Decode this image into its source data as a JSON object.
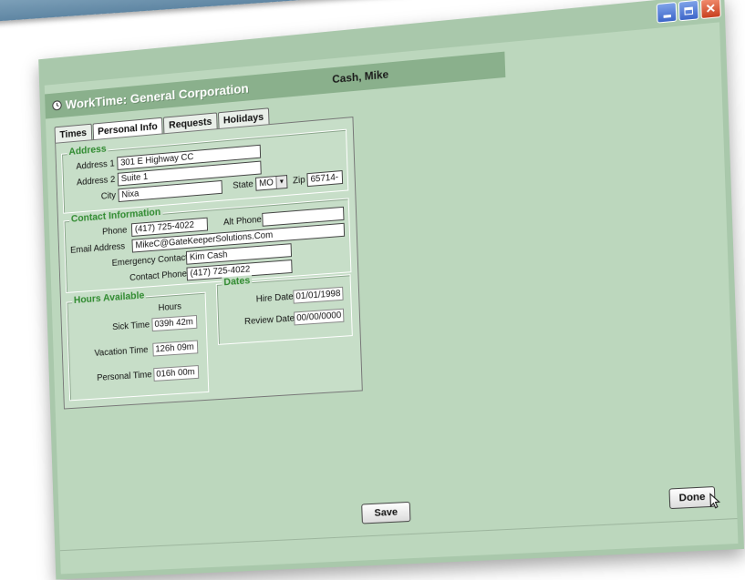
{
  "window": {
    "app_title": "WorkTime: General Corporation",
    "user_name": "Cash, Mike"
  },
  "tabs": [
    {
      "label": "Times"
    },
    {
      "label": "Personal Info"
    },
    {
      "label": "Requests"
    },
    {
      "label": "Holidays"
    }
  ],
  "address": {
    "group_label": "Address",
    "address1_label": "Address 1",
    "address1_value": "301 E Highway CC",
    "address2_label": "Address 2",
    "address2_value": "Suite 1",
    "city_label": "City",
    "city_value": "Nixa",
    "state_label": "State",
    "state_value": "MO",
    "zip_label": "Zip",
    "zip_value": "65714-"
  },
  "contact": {
    "group_label": "Contact Information",
    "phone_label": "Phone",
    "phone_value": "(417) 725-4022",
    "alt_phone_label": "Alt Phone",
    "alt_phone_value": "",
    "email_label": "Email Address",
    "email_value": "MikeC@GateKeeperSolutions.Com",
    "emergency_label": "Emergency Contact",
    "emergency_value": "Kim Cash",
    "contact_phone_label": "Contact Phone",
    "contact_phone_value": "(417) 725-4022"
  },
  "hours": {
    "group_label": "Hours Available",
    "column_header": "Hours",
    "rows": [
      {
        "label": "Sick Time",
        "value": "039h 42m"
      },
      {
        "label": "Vacation Time",
        "value": "126h 09m"
      },
      {
        "label": "Personal Time",
        "value": "016h 00m"
      }
    ]
  },
  "dates": {
    "group_label": "Dates",
    "hire_label": "Hire Date",
    "hire_value": "01/01/1998",
    "review_label": "Review Date",
    "review_value": "00/00/0000"
  },
  "buttons": {
    "save": "Save",
    "done": "Done"
  },
  "colors": {
    "window_bg": "#bcd7bd",
    "group_label": "#2f8a2f",
    "close_button": "#c8401f"
  }
}
